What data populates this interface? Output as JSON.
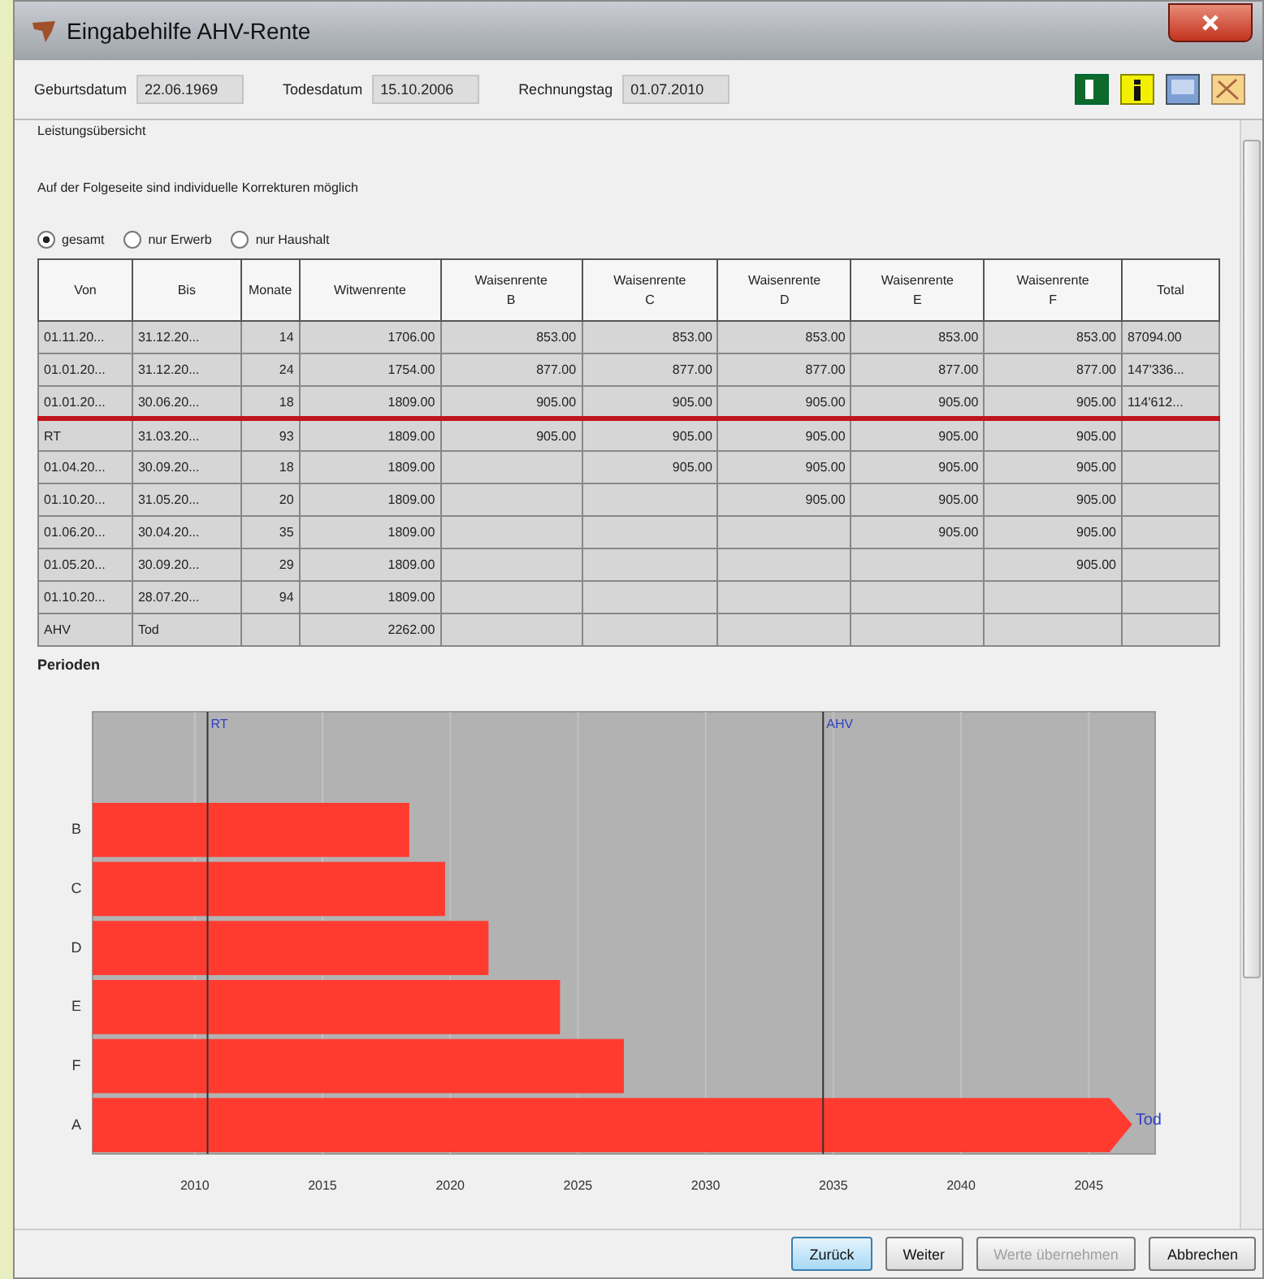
{
  "window": {
    "title": "Eingabehilfe AHV-Rente"
  },
  "fields": [
    {
      "label": "Geburtsdatum",
      "value": "22.06.1969"
    },
    {
      "label": "Todesdatum",
      "value": "15.10.2006"
    },
    {
      "label": "Rechnungstag",
      "value": "01.07.2010"
    }
  ],
  "section_title": "Leistungsübersicht",
  "note": "Auf der Folgeseite sind individuelle Korrekturen möglich",
  "radios": [
    {
      "label": "gesamt",
      "selected": true
    },
    {
      "label": "nur Erwerb",
      "selected": false
    },
    {
      "label": "nur Haushalt",
      "selected": false
    }
  ],
  "table": {
    "columns": [
      {
        "label": "Von"
      },
      {
        "label": "Bis"
      },
      {
        "label": "Monate"
      },
      {
        "label": "Witwenrente"
      },
      {
        "label": "Waisenrente",
        "line_2": "B"
      },
      {
        "label": "Waisenrente",
        "line_2": "C"
      },
      {
        "label": "Waisenrente",
        "line_2": "D"
      },
      {
        "label": "Waisenrente",
        "line_2": "E"
      },
      {
        "label": "Waisenrente",
        "line_2": "F"
      },
      {
        "label": "Total"
      }
    ],
    "rows": [
      {
        "marked": false,
        "cells": [
          "01.11.20...",
          "31.12.20...",
          "14",
          "1706.00",
          "853.00",
          "853.00",
          "853.00",
          "853.00",
          "853.00",
          "87094.00"
        ]
      },
      {
        "marked": false,
        "cells": [
          "01.01.20...",
          "31.12.20...",
          "24",
          "1754.00",
          "877.00",
          "877.00",
          "877.00",
          "877.00",
          "877.00",
          "147'336..."
        ]
      },
      {
        "marked": false,
        "cells": [
          "01.01.20...",
          "30.06.20...",
          "18",
          "1809.00",
          "905.00",
          "905.00",
          "905.00",
          "905.00",
          "905.00",
          "114'612..."
        ]
      },
      {
        "marked": true,
        "cells": [
          "RT",
          "31.03.20...",
          "93",
          "1809.00",
          "905.00",
          "905.00",
          "905.00",
          "905.00",
          "905.00",
          null
        ]
      },
      {
        "marked": false,
        "cells": [
          "01.04.20...",
          "30.09.20...",
          "18",
          "1809.00",
          null,
          "905.00",
          "905.00",
          "905.00",
          "905.00",
          null
        ]
      },
      {
        "marked": false,
        "cells": [
          "01.10.20...",
          "31.05.20...",
          "20",
          "1809.00",
          null,
          null,
          "905.00",
          "905.00",
          "905.00",
          null
        ]
      },
      {
        "marked": false,
        "cells": [
          "01.06.20...",
          "30.04.20...",
          "35",
          "1809.00",
          null,
          null,
          null,
          "905.00",
          "905.00",
          null
        ]
      },
      {
        "marked": false,
        "cells": [
          "01.05.20...",
          "30.09.20...",
          "29",
          "1809.00",
          null,
          null,
          null,
          null,
          "905.00",
          null
        ]
      },
      {
        "marked": false,
        "cells": [
          "01.10.20...",
          "28.07.20...",
          "94",
          "1809.00",
          null,
          null,
          null,
          null,
          null,
          null
        ]
      },
      {
        "marked": false,
        "cells": [
          "AHV",
          "Tod",
          null,
          "2262.00",
          null,
          null,
          null,
          null,
          null,
          null
        ]
      }
    ]
  },
  "periods": {
    "title": "Perioden",
    "chart_data": {
      "type": "bar",
      "orientation": "horizontal",
      "categories": [
        "B",
        "C",
        "D",
        "E",
        "F",
        "A"
      ],
      "series": [
        {
          "color": "#ff3b30",
          "values": [
            2018.4,
            2019.8,
            2021.5,
            2024.3,
            2026.8,
            2046.7
          ]
        }
      ],
      "xlim": [
        2006,
        2047.6
      ],
      "xticks": [
        2010,
        2015,
        2020,
        2025,
        2030,
        2035,
        2040,
        2045
      ],
      "grid": true,
      "ref_lines": [
        {
          "axis": "x",
          "value": 2010.5,
          "label": "RT"
        },
        {
          "axis": "x",
          "value": 2034.6,
          "label": "AHV"
        }
      ],
      "annotations": [
        {
          "x": 2046.7,
          "y": "A",
          "text": "Tod"
        }
      ]
    }
  },
  "buttons": [
    {
      "label": "Zurück",
      "selected": true,
      "disabled": false
    },
    {
      "label": "Weiter",
      "selected": false,
      "disabled": false
    },
    {
      "label": "Werte übernehmen",
      "selected": false,
      "disabled": true
    },
    {
      "label": "Abbrechen",
      "selected": false,
      "disabled": false
    }
  ]
}
